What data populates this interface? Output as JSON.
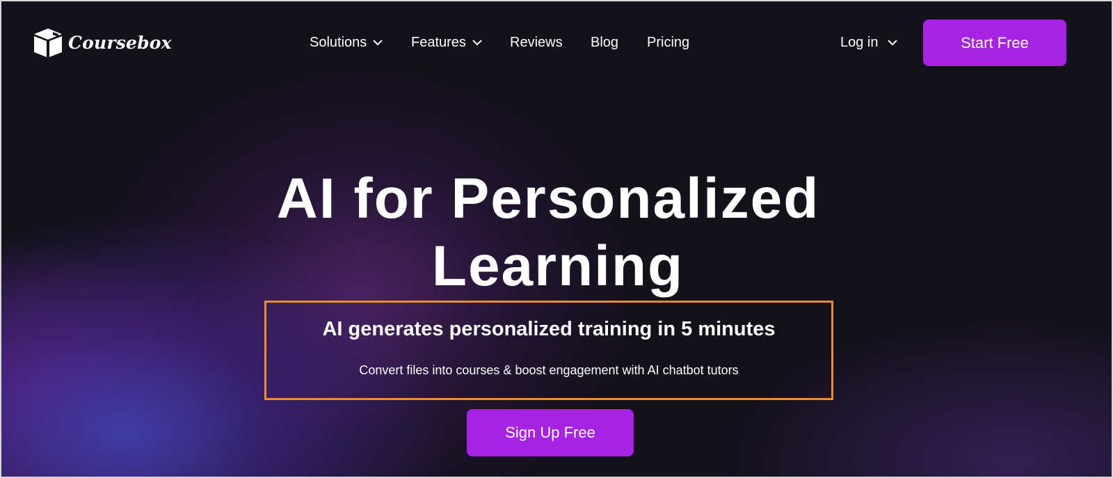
{
  "brand": {
    "name": "Coursebox",
    "logo_icon": "box-logo-icon"
  },
  "nav": {
    "items": [
      {
        "label": "Solutions",
        "has_dropdown": true
      },
      {
        "label": "Features",
        "has_dropdown": true
      },
      {
        "label": "Reviews",
        "has_dropdown": false
      },
      {
        "label": "Blog",
        "has_dropdown": false
      },
      {
        "label": "Pricing",
        "has_dropdown": false
      }
    ],
    "login_label": "Log in",
    "start_label": "Start Free"
  },
  "hero": {
    "title_line1": "AI for Personalized",
    "title_line2": "Learning",
    "subheading": "AI generates personalized training in 5 minutes",
    "description": "Convert files into courses & boost engagement with AI chatbot tutors",
    "cta_label": "Sign Up Free"
  },
  "colors": {
    "background": "#13111a",
    "accent": "#a623e4",
    "highlight_border": "#ee8e2a",
    "text": "#ffffff"
  }
}
